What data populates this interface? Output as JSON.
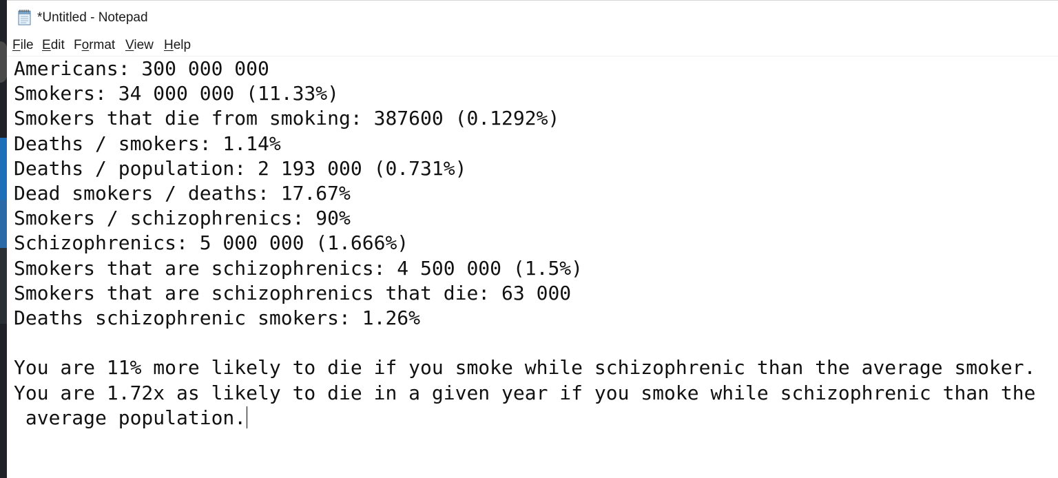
{
  "window": {
    "title": "*Untitled - Notepad",
    "app_icon": "notepad-icon"
  },
  "menu": {
    "items": [
      {
        "key": "F",
        "rest": "ile"
      },
      {
        "key": "E",
        "rest": "dit"
      },
      {
        "pre": "F",
        "key": "o",
        "rest": "rmat"
      },
      {
        "key": "V",
        "rest": "iew"
      },
      {
        "key": "H",
        "rest": "elp"
      }
    ]
  },
  "editor": {
    "lines": [
      "Americans: 300 000 000",
      "Smokers: 34 000 000 (11.33%)",
      "Smokers that die from smoking: 387600 (0.1292%)",
      "Deaths / smokers: 1.14%",
      "Deaths / population: 2 193 000 (0.731%)",
      "Dead smokers / deaths: 17.67%",
      "Smokers / schizophrenics: 90%",
      "Schizophrenics: 5 000 000 (1.666%)",
      "Smokers that are schizophrenics: 4 500 000 (1.5%)",
      "Smokers that are schizophrenics that die: 63 000",
      "Deaths schizophrenic smokers: 1.26%",
      "",
      "You are 11% more likely to die if you smoke while schizophrenic than the average smoker.",
      "You are 1.72x as likely to die in a given year if you smoke while schizophrenic than the",
      " average population."
    ]
  }
}
